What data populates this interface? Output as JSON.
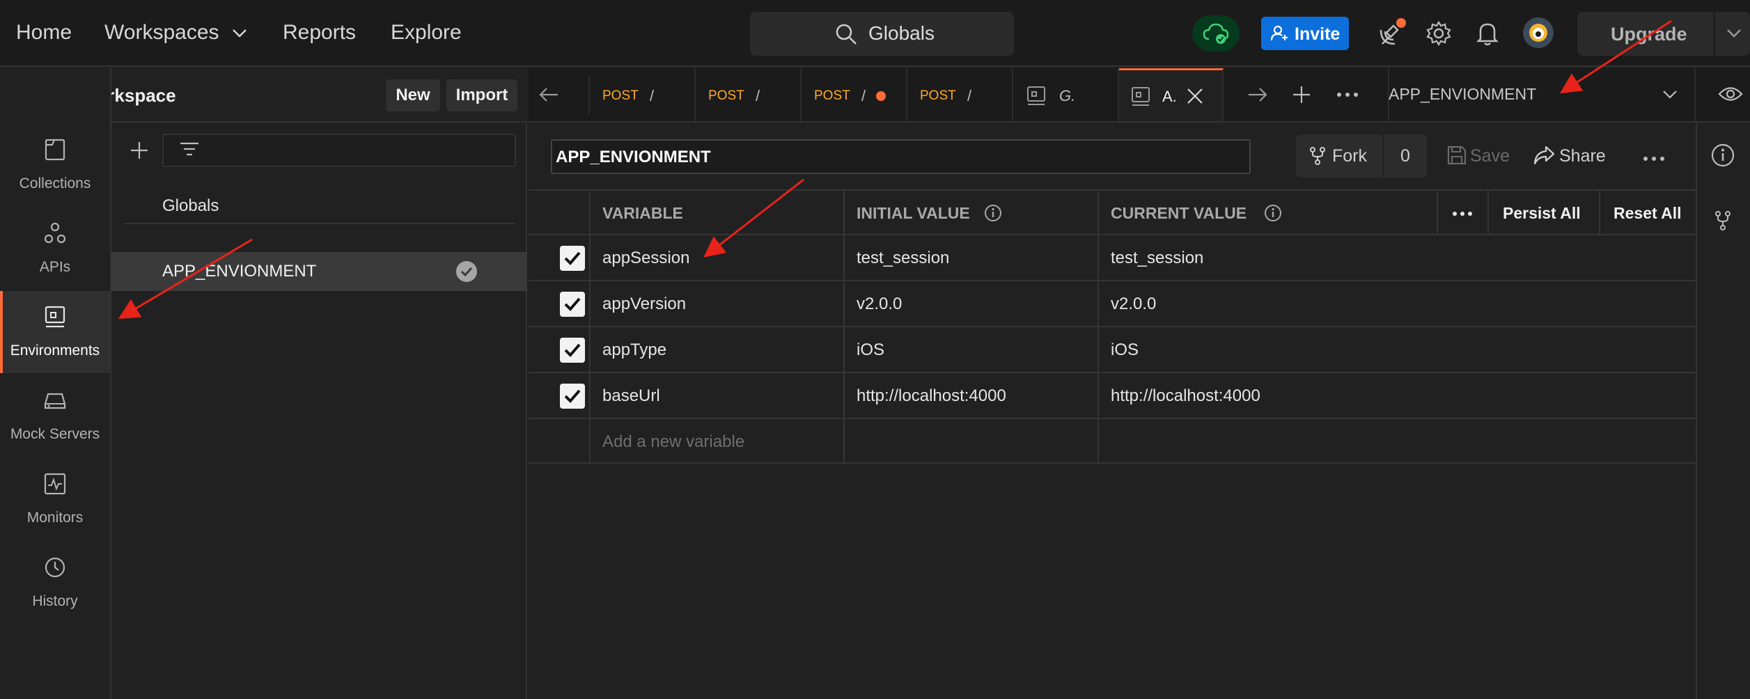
{
  "topnav": {
    "home": "Home",
    "workspaces": "Workspaces",
    "reports": "Reports",
    "explore": "Explore",
    "search_label": "Globals",
    "invite": "Invite",
    "upgrade": "Upgrade"
  },
  "workspace": {
    "name": "My Workspace",
    "new_btn": "New",
    "import_btn": "Import"
  },
  "rail": [
    {
      "label": "Collections",
      "icon": "collections-icon"
    },
    {
      "label": "APIs",
      "icon": "apis-icon"
    },
    {
      "label": "Environments",
      "icon": "environments-icon",
      "active": true
    },
    {
      "label": "Mock Servers",
      "icon": "mock-servers-icon"
    },
    {
      "label": "Monitors",
      "icon": "monitors-icon"
    },
    {
      "label": "History",
      "icon": "history-icon"
    }
  ],
  "sidebar": {
    "globals": "Globals",
    "selected_env": "APP_ENVIONMENT"
  },
  "tabs": [
    {
      "method": "POST",
      "path": "/"
    },
    {
      "method": "POST",
      "path": "/"
    },
    {
      "method": "POST",
      "path": "/"
    },
    {
      "method": "POST",
      "path": "/"
    },
    {
      "label": "G."
    },
    {
      "label": "A."
    }
  ],
  "env_selector": "APP_ENVIONMENT",
  "editor": {
    "env_name": "APP_ENVIONMENT",
    "fork": "Fork",
    "fork_count": "0",
    "save": "Save",
    "share": "Share"
  },
  "table": {
    "headers": {
      "variable": "VARIABLE",
      "initial": "INITIAL VALUE",
      "current": "CURRENT VALUE",
      "persist_all": "Persist All",
      "reset_all": "Reset All"
    },
    "rows": [
      {
        "variable": "appSession",
        "initial": "test_session",
        "current": "test_session",
        "enabled": true
      },
      {
        "variable": "appVersion",
        "initial": "v2.0.0",
        "current": "v2.0.0",
        "enabled": true
      },
      {
        "variable": "appType",
        "initial": "iOS",
        "current": "iOS",
        "enabled": true
      },
      {
        "variable": "baseUrl",
        "initial": "http://localhost:4000",
        "current": "http://localhost:4000",
        "enabled": true
      }
    ],
    "add_placeholder": "Add a new variable"
  },
  "colors": {
    "accent": "#ff6c37",
    "invite_blue": "#0d6fdc",
    "post_method": "#ffa928",
    "annotation_red": "#e8231a"
  }
}
